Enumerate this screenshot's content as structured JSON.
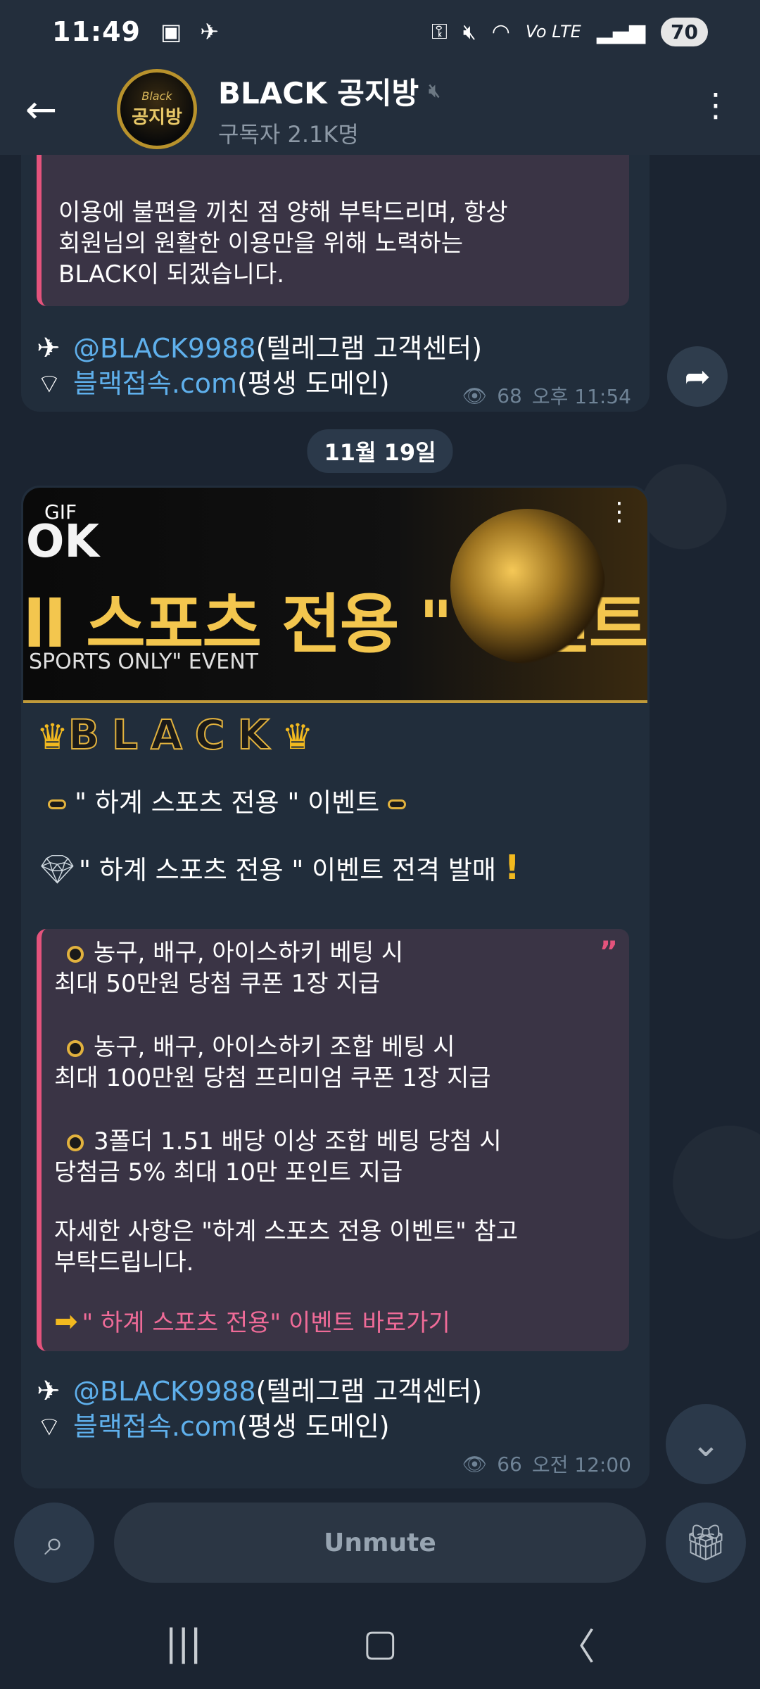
{
  "status_bar": {
    "time": "11:49",
    "battery": "70",
    "network": "Vo LTE"
  },
  "header": {
    "channel_name": "BLACK 공지방",
    "subscribers": "구독자 2.1K명",
    "avatar_small": "Black",
    "avatar_big": "공지방"
  },
  "message1": {
    "quote_lines": [
      "이용에 불편을 끼친 점 양해 부탁드리며, 항상",
      "회원님의 원활한 이용만을 위해 노력하는",
      "BLACK이 되겠습니다."
    ],
    "telegram_handle": "@BLACK9988",
    "telegram_suffix": " (텔레그램 고객센터)",
    "domain_link": "블랙접속.com",
    "domain_suffix": " (평생 도메인)",
    "views": "68",
    "time": "오후 11:54"
  },
  "date_separator": "11월 19일",
  "message2": {
    "gif_label": "GIF",
    "banner_ok": "OK",
    "banner_main": "ll 스포츠 전용 \" 이벤트",
    "banner_sub": "SPORTS ONLY\" EVENT",
    "black_title": "BLACK",
    "event_title": "\" 하계 스포츠 전용 \" 이벤트",
    "event_launch": "\" 하계 스포츠 전용 \" 이벤트 전격 발매",
    "quote": {
      "item1_a": "농구, 배구, 아이스하키 베팅 시",
      "item1_b": "최대 50만원 당첨 쿠폰 1장 지급",
      "item2_a": "농구, 배구, 아이스하키 조합 베팅 시",
      "item2_b": "최대 100만원 당첨 프리미엄 쿠폰 1장 지급",
      "item3_a": "3폴더 1.51 배당 이상 조합 베팅 당첨 시",
      "item3_b": "당첨금 5% 최대 10만 포인트 지급",
      "detail_a": "자세한 사항은 \"하계 스포츠 전용 이벤트\" 참고",
      "detail_b": "부탁드립니다.",
      "link": "\" 하계 스포츠 전용\" 이벤트 바로가기"
    },
    "telegram_handle": "@BLACK9988",
    "telegram_suffix": " (텔레그램 고객센터)",
    "domain_link": "블랙접속.com",
    "domain_suffix": " (평생 도메인)",
    "views": "66",
    "time": "오전 12:00"
  },
  "bottom": {
    "unmute_label": "Unmute"
  },
  "icons": {
    "back": "arrow-left",
    "more": "vertical-dots",
    "share": "forward",
    "search": "search",
    "gift": "gift",
    "scroll_down": "chevron-down"
  },
  "colors": {
    "background": "#1b2431",
    "header": "#232e3c",
    "bubble": "#212d3b",
    "quote_bar": "#e4537c",
    "link": "#5fb0ec",
    "gold": "#f2b91f"
  }
}
